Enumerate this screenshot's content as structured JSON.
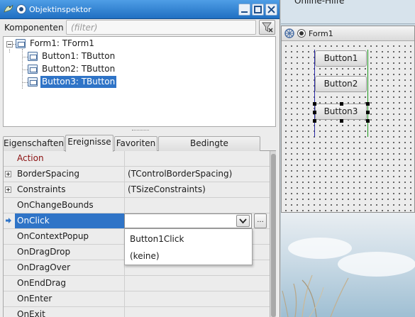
{
  "inspector": {
    "title": "Objektinspektor",
    "search": {
      "label": "Komponenten",
      "placeholder": "(filter)"
    },
    "tree": [
      {
        "label": "Form1: TForm1",
        "selected": false
      },
      {
        "label": "Button1: TButton",
        "selected": false
      },
      {
        "label": "Button2: TButton",
        "selected": false
      },
      {
        "label": "Button3: TButton",
        "selected": true
      }
    ],
    "tabs": [
      "Eigenschaften",
      "Ereignisse",
      "Favoriten",
      "Bedingte Eigenschaften"
    ],
    "active_tab": "Ereignisse",
    "properties": [
      {
        "name": "Action",
        "value": ""
      },
      {
        "name": "BorderSpacing",
        "value": "(TControlBorderSpacing)"
      },
      {
        "name": "Constraints",
        "value": "(TSizeConstraints)"
      },
      {
        "name": "OnChangeBounds",
        "value": ""
      },
      {
        "name": "OnClick",
        "value": ""
      },
      {
        "name": "OnContextPopup",
        "value": ""
      },
      {
        "name": "OnDragDrop",
        "value": ""
      },
      {
        "name": "OnDragOver",
        "value": ""
      },
      {
        "name": "OnEndDrag",
        "value": ""
      },
      {
        "name": "OnEnter",
        "value": ""
      },
      {
        "name": "OnExit",
        "value": ""
      }
    ],
    "event_editor": {
      "ellipsis": "...",
      "dropdown_options": [
        "Button1Click",
        "(keine)"
      ]
    }
  },
  "help_window": {
    "title": "Online-Hilfe"
  },
  "designer": {
    "title": "Form1",
    "buttons": [
      "Button1",
      "Button2",
      "Button3"
    ]
  },
  "colors": {
    "titlebar": "#2f74c7",
    "selection": "#2f74c7",
    "category_text": "#8b1010"
  }
}
